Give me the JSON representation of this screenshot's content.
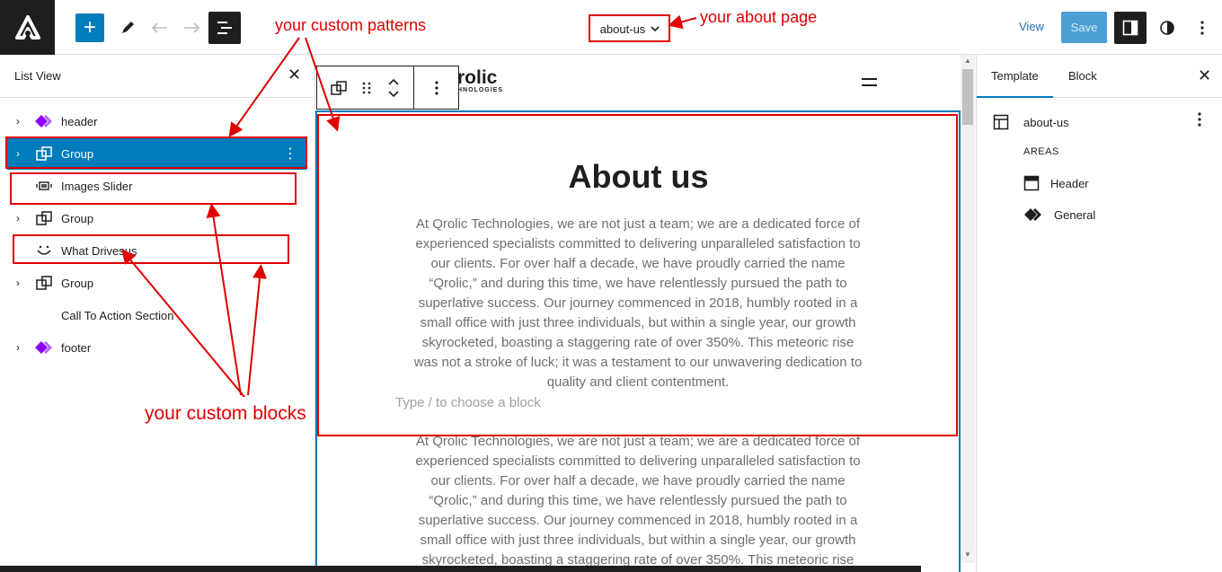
{
  "topbar": {
    "document_title": "about-us",
    "view_label": "View",
    "save_label": "Save"
  },
  "list_view": {
    "title": "List View",
    "items": [
      {
        "label": "header",
        "icon": "template-part-diamond-icon",
        "expandable": true
      },
      {
        "label": "Group",
        "icon": "group-icon",
        "expandable": true,
        "selected": true
      },
      {
        "label": "Images Slider",
        "icon": "slider-icon",
        "expandable": false
      },
      {
        "label": "Group",
        "icon": "group-icon",
        "expandable": true
      },
      {
        "label": "What Drivesus",
        "icon": "smiley-icon",
        "expandable": false
      },
      {
        "label": "Group",
        "icon": "group-icon",
        "expandable": true
      },
      {
        "label": "Call To Action Section",
        "icon": "",
        "expandable": false
      },
      {
        "label": "footer",
        "icon": "template-part-diamond-icon",
        "expandable": true
      }
    ]
  },
  "canvas": {
    "site_logo": "rolic",
    "site_logo_sub": "HNOLOGIES",
    "heading": "About us",
    "paragraph_lines": [
      "At Qrolic Technologies, we are not just a team; we are a dedicated force of",
      "experienced specialists committed to delivering unparalleled satisfaction to",
      "our clients. For over half a decade, we have proudly carried the name",
      "“Qrolic,” and during this time, we have relentlessly pursued the path to",
      "superlative success. Our journey commenced in 2018, humbly rooted in a",
      "small office with just three individuals, but within a single year, our growth",
      "skyrocketed, boasting a staggering rate of over 350%. This meteoric rise",
      "was not a stroke of luck; it was a testament to our unwavering dedication to",
      "quality and client contentment."
    ],
    "type_hint": "Type / to choose a block",
    "paragraph2_lines": [
      "At Qrolic Technologies, we are not just a team; we are a dedicated force of",
      "experienced specialists committed to delivering unparalleled satisfaction to",
      "our clients. For over half a decade, we have proudly carried the name",
      "“Qrolic,” and during this time, we have relentlessly pursued the path to",
      "superlative success. Our journey commenced in 2018, humbly rooted in a",
      "small office with just three individuals, but within a single year, our growth",
      "skyrocketed, boasting a staggering rate of over 350%. This meteoric rise"
    ]
  },
  "sidebar": {
    "tab_template": "Template",
    "tab_block": "Block",
    "template_name": "about-us",
    "areas_label": "AREAS",
    "areas": [
      "Header",
      "General"
    ]
  },
  "annotations": {
    "patterns": "your custom patterns",
    "about_page": "your about page",
    "blocks": "your custom blocks"
  },
  "colors": {
    "accent": "#007cba",
    "annotation": "#e00000",
    "dark": "#1e1e1e"
  }
}
